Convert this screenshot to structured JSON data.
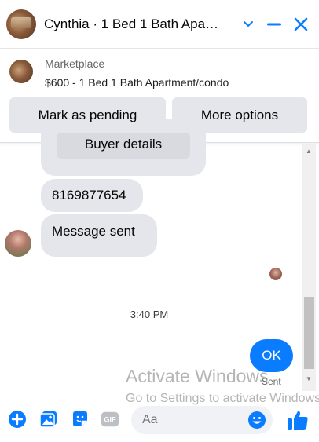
{
  "header": {
    "title": "Cynthia · 1 Bed 1 Bath Apa…"
  },
  "marketplace": {
    "label": "Marketplace",
    "item": "$600 - 1 Bed 1 Bath Apartment/condo",
    "buttons": {
      "pending": "Mark as pending",
      "more": "More options"
    }
  },
  "chat": {
    "buyer_details": "Buyer details",
    "phone": "8169877654",
    "message_sent": "Message sent",
    "timestamp": "3:40 PM",
    "ok": "OK",
    "sent_status": "Sent"
  },
  "watermark": {
    "line1": "Activate Windows",
    "line2": "Go to Settings to activate Windows."
  },
  "composer": {
    "placeholder": "Aa"
  },
  "colors": {
    "accent": "#0a7cff",
    "bubble": "#e4e6eb"
  }
}
